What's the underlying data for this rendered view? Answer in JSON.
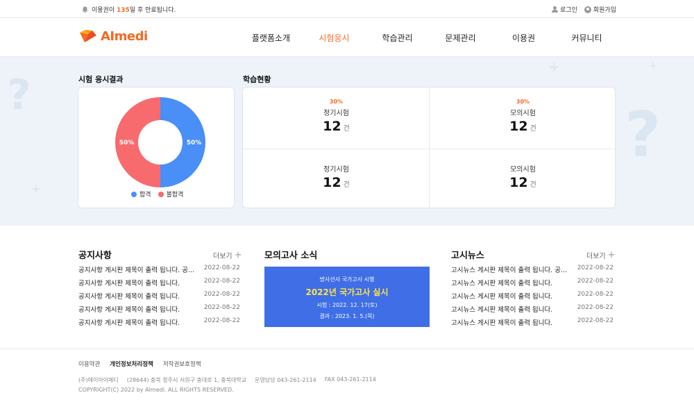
{
  "topbar": {
    "notice_prefix": "이용권이",
    "notice_days": "135",
    "notice_suffix": "일 후 만료됩니다.",
    "login": "로그인",
    "signup": "회원가입"
  },
  "header": {
    "logo_text": "AImedi",
    "nav": [
      "플랫폼소개",
      "시험응시",
      "학습관리",
      "문제관리",
      "이용권",
      "커뮤니티"
    ],
    "active_nav": "시험응시",
    "accent_color": "#f26b22"
  },
  "exam_result": {
    "title": "시험 응시결과",
    "chart_data": {
      "type": "pie",
      "donut": true,
      "categories": [
        "합격",
        "불합격"
      ],
      "values": [
        50,
        50
      ],
      "labels": [
        "50%",
        "50%"
      ],
      "colors": [
        "#4a8ef7",
        "#f76b6f"
      ],
      "legend_position": "bottom"
    }
  },
  "learning_status": {
    "title": "학습현황",
    "cells": [
      {
        "pct": "30%",
        "label": "정기시험",
        "value": "12",
        "unit": "건"
      },
      {
        "pct": "30%",
        "label": "모의시험",
        "value": "12",
        "unit": "건"
      },
      {
        "pct": "",
        "label": "정기시험",
        "value": "12",
        "unit": "건"
      },
      {
        "pct": "",
        "label": "모의시험",
        "value": "12",
        "unit": "건"
      }
    ]
  },
  "notice": {
    "title": "공지사항",
    "more": "더보기",
    "items": [
      {
        "title": "공지사항 게시판 제목이 출력 됩니다. 공...",
        "date": "2022-08-22"
      },
      {
        "title": "공지사항 게시판 제목이 출력 됩니다.",
        "date": "2022-08-22"
      },
      {
        "title": "공지사항 게시판 제목이 출력 됩니다.",
        "date": "2022-08-22"
      },
      {
        "title": "공지사항 게시판 제목이 출력 됩니다.",
        "date": "2022-08-22"
      },
      {
        "title": "공지사항 게시판 제목이 출력 됩니다.",
        "date": "2022-08-22"
      }
    ]
  },
  "mock_news": {
    "title": "모의고사 소식",
    "banner_line1": "방사선사 국가고사 시행",
    "banner_line2": "2022년 국가고사 실시",
    "banner_line3": "시험 : 2022. 12. 17(토)",
    "banner_line4": "결과 : 2023. 1. 5.(목)"
  },
  "exam_news": {
    "title": "고시뉴스",
    "more": "더보기",
    "items": [
      {
        "title": "고시뉴스 게시판 제목이 출력 됩니다. 공...",
        "date": "2022-08-22"
      },
      {
        "title": "고시뉴스 게시판 제목이 출력 됩니다.",
        "date": "2022-08-22"
      },
      {
        "title": "고시뉴스 게시판 제목이 출력 됩니다.",
        "date": "2022-08-22"
      },
      {
        "title": "고시뉴스 게시판 제목이 출력 됩니다.",
        "date": "2022-08-22"
      },
      {
        "title": "고시뉴스 게시판 제목이 출력 됩니다.",
        "date": "2022-08-22"
      }
    ]
  },
  "footer": {
    "links": [
      "이용약관",
      "개인정보처리정책",
      "저작권보호정책"
    ],
    "company": "(주)에이아이메디",
    "address": "(28644) 충북 청주시 서원구 충대로 1, 충북대학교",
    "phone": "운영담당 043-261-2114",
    "fax": "FAX 043-261-2114",
    "copyright": "COPYRIGHT(C) 2022 by AImedi. ALL RIGHTS RESERVED."
  }
}
